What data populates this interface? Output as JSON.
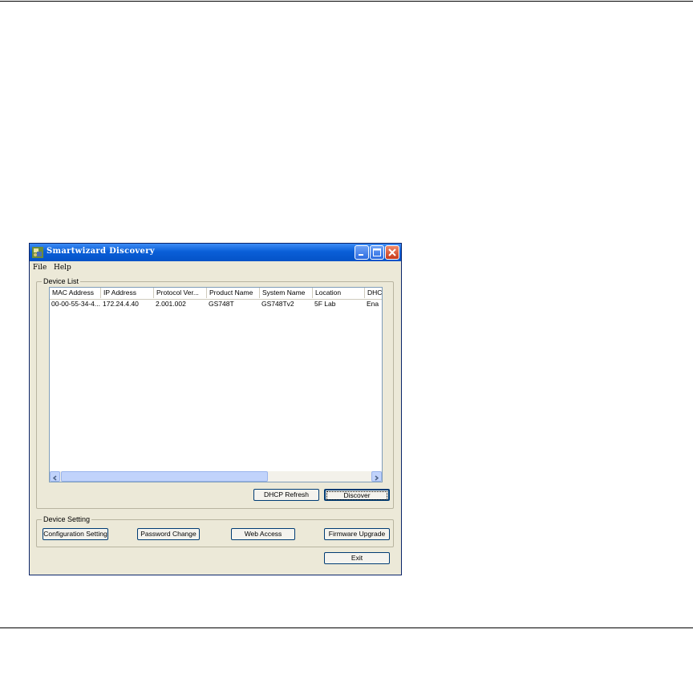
{
  "window": {
    "title": "Smartwizard Discovery",
    "titlebar_color": "#0a5fd8",
    "face_color": "#ece9d8",
    "controls": [
      "minimize-icon",
      "maximize-icon",
      "close-icon"
    ]
  },
  "menu": {
    "items": [
      "File",
      "Help"
    ]
  },
  "device_list": {
    "label": "Device List",
    "columns": [
      "MAC Address",
      "IP Address",
      "Protocol Ver...",
      "Product Name",
      "System Name",
      "Location",
      "DHC"
    ],
    "rows": [
      [
        "00-00-55-34-4...",
        "172.24.4.40",
        "2.001.002",
        "GS748T",
        "GS748Tv2",
        "5F Lab",
        "Ena"
      ]
    ],
    "scroll_left_glyph": "‹",
    "scroll_right_glyph": "›"
  },
  "buttons": {
    "dhcp_refresh": "DHCP Refresh",
    "discover": "Discover",
    "configuration_setting": "Configuration Setting",
    "password_change": "Password Change",
    "web_access": "Web Access",
    "firmware_upgrade": "Firmware Upgrade",
    "exit": "Exit"
  },
  "device_setting": {
    "label": "Device Setting"
  }
}
